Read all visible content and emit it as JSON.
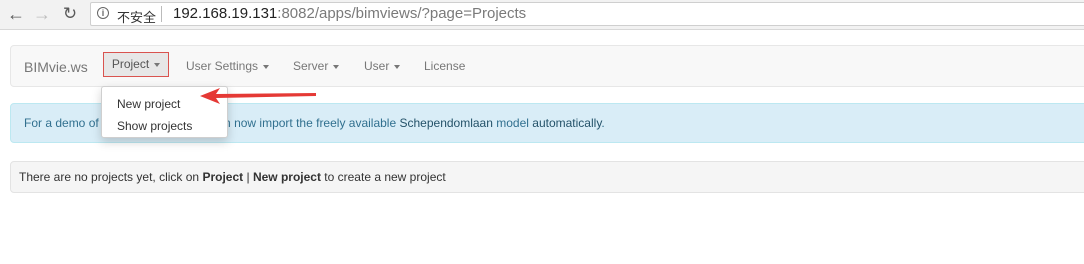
{
  "browser": {
    "back_icon": "arrow-left-icon",
    "forward_icon": "arrow-right-icon",
    "reload_icon": "reload-icon",
    "security_label": "不安全",
    "url_host": "192.168.19.131",
    "url_rest": ":8082/apps/bimviews/?page=Projects"
  },
  "navbar": {
    "brand": "BIMvie.ws",
    "items": [
      {
        "label": "Project"
      },
      {
        "label": "User Settings"
      },
      {
        "label": "Server"
      },
      {
        "label": "User"
      },
      {
        "label": "License"
      }
    ]
  },
  "dropdown": {
    "items": [
      {
        "label": "New project"
      },
      {
        "label": "Show projects"
      }
    ]
  },
  "alert": {
    "prefix": "For a demo of",
    "middle": "ou can now import the freely available",
    "link1": "Schependomlaan",
    "between": "model",
    "link2": "automatically",
    "end": "."
  },
  "well": {
    "part1": "There are no projects yet, click on",
    "bold1": "Project",
    "sep": "|",
    "bold2": "New project",
    "part2": "to create a new project"
  },
  "colors": {
    "annotation_red": "#e53935",
    "alert_bg": "#d9edf7",
    "alert_text": "#31708f"
  }
}
